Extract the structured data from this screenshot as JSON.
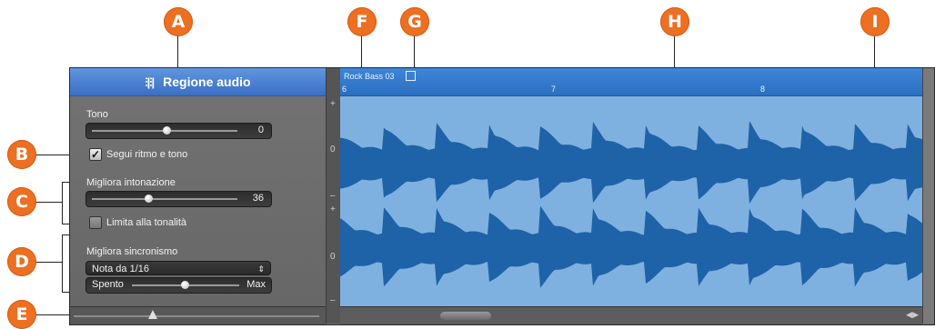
{
  "callouts": [
    "A",
    "B",
    "C",
    "D",
    "E",
    "F",
    "G",
    "H",
    "I"
  ],
  "panel": {
    "title": "Regione audio",
    "tono_label": "Tono",
    "tono_value": "0",
    "segui_label": "Segui ritmo e tono",
    "migliora_intonazione_label": "Migliora intonazione",
    "migliora_intonazione_value": "36",
    "limita_label": "Limita alla tonalità",
    "migliora_sincronismo_label": "Migliora sincronismo",
    "nota_select": "Nota da 1/16",
    "spento_label": "Spento",
    "max_label": "Max",
    "segui_checked": true,
    "limita_checked": false
  },
  "meter": {
    "plus_top": "+",
    "zero_top": "0",
    "minus_top": "–",
    "plus_bot": "+",
    "zero_bot": "0",
    "minus_bot": "–"
  },
  "editor": {
    "region_name": "Rock Bass 03",
    "ruler_marks": [
      "6",
      "7",
      "8"
    ],
    "colors": {
      "region_bg": "#7fb1e0",
      "waveform": "#1e62a8",
      "header": "#3a6fc4",
      "callout": "#ec6f22"
    }
  },
  "icons": [
    "waveform-icon",
    "loop-icon",
    "checkbox-icon",
    "select-arrow-icon",
    "zoom-slider-icon",
    "scroll-arrow-icon"
  ]
}
